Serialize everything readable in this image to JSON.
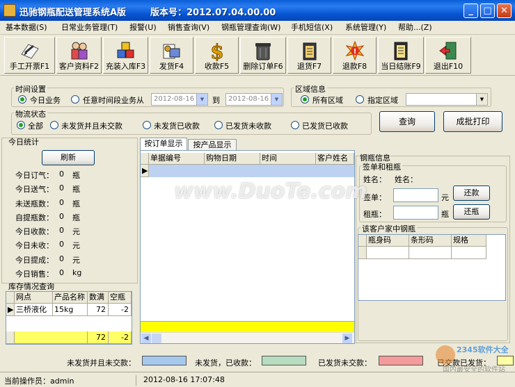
{
  "window": {
    "title": "迅驰钢瓶配送管理系统A版",
    "version": "版本号：2012.07.04.00.00",
    "minimize": "_",
    "maximize": "□",
    "close": "✕"
  },
  "menu": [
    "基本数据(S)",
    "日常业务管理(T)",
    "报警(U)",
    "销售查询(V)",
    "钢瓶管理查询(W)",
    "手机短信(X)",
    "系统管理(Y)",
    "帮助...(Z)"
  ],
  "toolbar": [
    {
      "label": "手工开票F1",
      "icon": "pen-paper-icon"
    },
    {
      "label": "客户资料F2",
      "icon": "people-icon"
    },
    {
      "label": "充装入库F3",
      "icon": "cubes-icon"
    },
    {
      "label": "发货F4",
      "icon": "delivery-icon"
    },
    {
      "label": "收款F5",
      "icon": "dollar-icon"
    },
    {
      "label": "删除订单F6",
      "icon": "trash-icon"
    },
    {
      "label": "退货F7",
      "icon": "clipboard-icon"
    },
    {
      "label": "退款F8",
      "icon": "alert-icon"
    },
    {
      "label": "当日结账F9",
      "icon": "ledger-icon"
    },
    {
      "label": "退出F10",
      "icon": "exit-door-icon"
    }
  ],
  "time_group": {
    "label": "时间设置",
    "opt_today": "今日业务",
    "opt_range": "任意时间段业务从",
    "from_date": "2012-08-16",
    "to_label": "到",
    "to_date": "2012-08-16"
  },
  "area_group": {
    "label": "区域信息",
    "opt_all": "所有区域",
    "opt_specific": "指定区域",
    "area_value": ""
  },
  "logistics_group": {
    "label": "物流状态",
    "options": [
      "全部",
      "未发货并且未交款",
      "未发货已收款",
      "已发货未收款",
      "已发货已收款"
    ]
  },
  "buttons": {
    "query": "查询",
    "print": "成批打印",
    "refresh": "刷新",
    "return_tag": "还款",
    "return_bottle": "还瓶"
  },
  "today_stats": {
    "title": "今日统计",
    "rows": [
      {
        "label": "今日订气：",
        "value": "0",
        "unit": "瓶"
      },
      {
        "label": "今日送气：",
        "value": "0",
        "unit": "瓶"
      },
      {
        "label": "未送瓶数：",
        "value": "0",
        "unit": "瓶"
      },
      {
        "label": "自提瓶数：",
        "value": "0",
        "unit": "瓶"
      },
      {
        "label": "今日收款：",
        "value": "0",
        "unit": "元"
      },
      {
        "label": "今日未收：",
        "value": "0",
        "unit": "元"
      },
      {
        "label": "今日提成：",
        "value": "0",
        "unit": "元"
      },
      {
        "label": "今日销售：",
        "value": "0",
        "unit": "kg"
      }
    ]
  },
  "inventory": {
    "title": "库存情况查询",
    "headers": [
      "网点",
      "产品名称",
      "数满",
      "空瓶"
    ],
    "rows": [
      [
        "三桥液化",
        "15kg",
        "72",
        "-2"
      ]
    ],
    "totals": [
      "",
      "",
      "72",
      "-2"
    ]
  },
  "tabs": [
    "按订单显示",
    "按产品显示"
  ],
  "order_grid": {
    "headers": [
      "单据编号",
      "购物日期",
      "时间",
      "客户姓名"
    ]
  },
  "bottle_info": {
    "title": "钢瓶信息",
    "sign_group": "签单和租瓶",
    "name_label": "姓名：",
    "name_value": "姓名：",
    "sign_label": "签单：",
    "sign_unit": "元",
    "rent_label": "租瓶：",
    "rent_unit": "瓶",
    "customer_bottles": "该客户家中钢瓶",
    "headers": [
      "瓶身码",
      "条形码",
      "规格"
    ]
  },
  "legend": [
    {
      "label": "未发货并且未交款：",
      "color": "#a6c8ec"
    },
    {
      "label": "未发货，已收款：",
      "color": "#b7dcc0"
    },
    {
      "label": "已发货未交款：",
      "color": "#f49b9b"
    },
    {
      "label": "已交款已发货：",
      "color": "#ffffa6"
    }
  ],
  "status": {
    "operator": "当前操作员：admin",
    "datetime": "2012-08-16  17:07:48"
  },
  "watermark": {
    "main": "www.DuoTe.com",
    "corner": "2345软件大全",
    "corner_sub": "国内最安全的软件站"
  }
}
